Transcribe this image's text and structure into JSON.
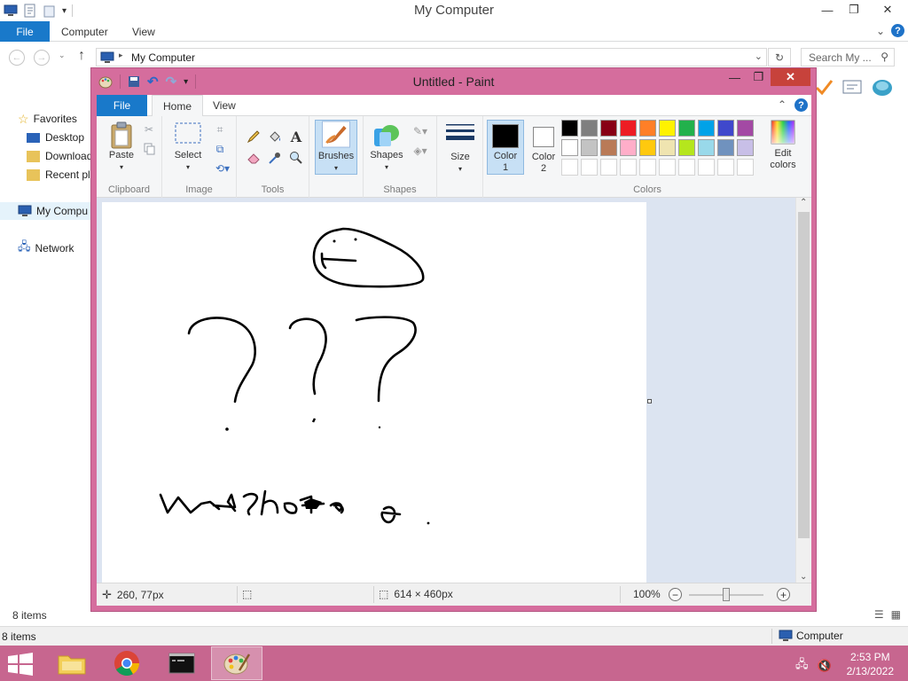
{
  "explorer": {
    "title": "My Computer",
    "ribbon_tabs": [
      "File",
      "Computer",
      "View"
    ],
    "address": "My Computer",
    "search_placeholder": "Search My ...",
    "sidebar": {
      "favorites": "Favorites",
      "desktop": "Desktop",
      "downloads": "Download",
      "recent": "Recent pla",
      "mycomputer": "My Compu",
      "network": "Network"
    },
    "status_count": "8 items",
    "bottom_count": "8 items",
    "bottom_location": "Computer"
  },
  "paint": {
    "title": "Untitled - Paint",
    "tabs": {
      "file": "File",
      "home": "Home",
      "view": "View"
    },
    "groups": {
      "clipboard": "Clipboard",
      "image": "Image",
      "tools": "Tools",
      "shapes": "Shapes",
      "colors": "Colors"
    },
    "buttons": {
      "paste": "Paste",
      "select": "Select",
      "brushes": "Brushes",
      "shapes": "Shapes",
      "size": "Size",
      "color1_a": "Color",
      "color1_b": "1",
      "color2_a": "Color",
      "color2_b": "2",
      "edit_colors_a": "Edit",
      "edit_colors_b": "colors"
    },
    "color1": "#000000",
    "color2": "#ffffff",
    "palette": [
      "#000000",
      "#7f7f7f",
      "#880015",
      "#ed1c24",
      "#ff7f27",
      "#fff200",
      "#22b14c",
      "#00a2e8",
      "#3f48cc",
      "#a349a4",
      "#ffffff",
      "#c3c3c3",
      "#b97a57",
      "#ffaec9",
      "#ffc90e",
      "#efe4b0",
      "#b5e61d",
      "#99d9ea",
      "#7092be",
      "#c8bfe7"
    ],
    "status": {
      "cursor_pos": "260, 77px",
      "selection_size": "",
      "canvas_size": "614 × 460px",
      "zoom": "100%"
    }
  },
  "taskbar": {
    "time": "2:53 PM",
    "date": "2/13/2022"
  },
  "colors": {
    "paint_frame": "#d56d9d",
    "taskbar": "#c7668f",
    "accent_blue": "#1979ca"
  }
}
